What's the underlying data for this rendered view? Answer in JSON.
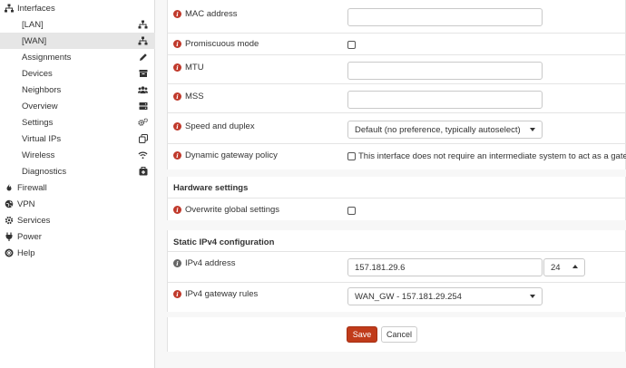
{
  "sidebar": {
    "interfaces_label": "Interfaces",
    "sub_items": [
      {
        "label": "[LAN]",
        "icon": "sitemap-icon"
      },
      {
        "label": "[WAN]",
        "icon": "sitemap-icon"
      },
      {
        "label": "Assignments",
        "icon": "pencil-icon"
      },
      {
        "label": "Devices",
        "icon": "archive-icon"
      },
      {
        "label": "Neighbors",
        "icon": "users-icon"
      },
      {
        "label": "Overview",
        "icon": "server-icon"
      },
      {
        "label": "Settings",
        "icon": "cogs-icon"
      },
      {
        "label": "Virtual IPs",
        "icon": "clone-icon"
      },
      {
        "label": "Wireless",
        "icon": "wifi-icon"
      },
      {
        "label": "Diagnostics",
        "icon": "medkit-icon"
      }
    ],
    "top_items": [
      {
        "label": "Firewall",
        "icon": "fire-icon"
      },
      {
        "label": "VPN",
        "icon": "globe-icon"
      },
      {
        "label": "Services",
        "icon": "cog-icon"
      },
      {
        "label": "Power",
        "icon": "plug-icon"
      },
      {
        "label": "Help",
        "icon": "lifebuoy-icon"
      }
    ]
  },
  "form": {
    "mac_address_label": "MAC address",
    "mac_address_value": "",
    "promiscuous_label": "Promiscuous mode",
    "mtu_label": "MTU",
    "mtu_value": "",
    "mss_label": "MSS",
    "mss_value": "",
    "speed_label": "Speed and duplex",
    "speed_value": "Default (no preference, typically autoselect)",
    "gateway_policy_label": "Dynamic gateway policy",
    "gateway_policy_text": "This interface does not require an intermediate system to act as a gateway",
    "hardware_heading": "Hardware settings",
    "overwrite_label": "Overwrite global settings",
    "static_heading": "Static IPv4 configuration",
    "ipv4_label": "IPv4 address",
    "ipv4_value": "157.181.29.6",
    "prefix_value": "24",
    "gateway_rules_label": "IPv4 gateway rules",
    "gateway_rules_value": "WAN_GW - 157.181.29.254",
    "save_label": "Save",
    "cancel_label": "Cancel"
  },
  "colors": {
    "accent": "#c03b1a",
    "info": "#c0392b"
  }
}
